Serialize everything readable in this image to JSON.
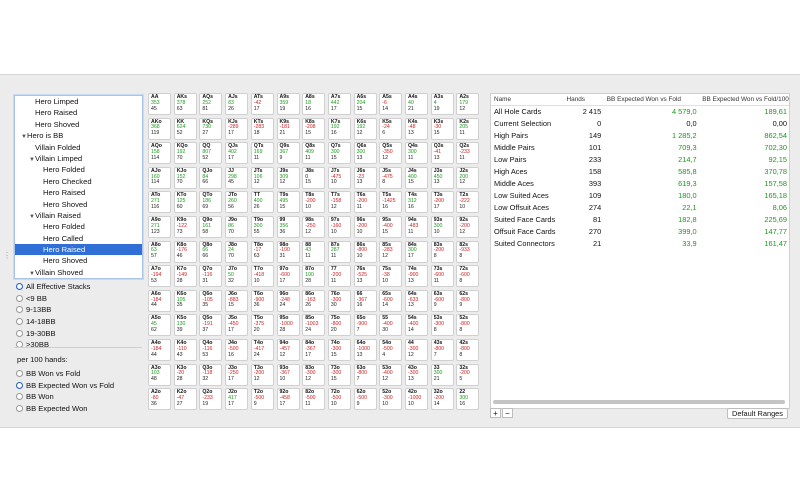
{
  "tree": {
    "items": [
      {
        "label": "Hero Limped",
        "indent": 2,
        "arrow": false,
        "selected": false
      },
      {
        "label": "Hero Raised",
        "indent": 2,
        "arrow": false,
        "selected": false
      },
      {
        "label": "Hero Shoved",
        "indent": 2,
        "arrow": false,
        "selected": false
      },
      {
        "label": "Hero is BB",
        "indent": 1,
        "arrow": true,
        "selected": false
      },
      {
        "label": "Villain Folded",
        "indent": 2,
        "arrow": false,
        "selected": false
      },
      {
        "label": "Villain Limped",
        "indent": 2,
        "arrow": true,
        "selected": false
      },
      {
        "label": "Hero Folded",
        "indent": 3,
        "arrow": false,
        "selected": false
      },
      {
        "label": "Hero Checked",
        "indent": 3,
        "arrow": false,
        "selected": false
      },
      {
        "label": "Hero Raised",
        "indent": 3,
        "arrow": false,
        "selected": false
      },
      {
        "label": "Hero Shoved",
        "indent": 3,
        "arrow": false,
        "selected": false
      },
      {
        "label": "Villain Raised",
        "indent": 2,
        "arrow": true,
        "selected": false
      },
      {
        "label": "Hero Folded",
        "indent": 3,
        "arrow": false,
        "selected": false
      },
      {
        "label": "Hero Called",
        "indent": 3,
        "arrow": false,
        "selected": false
      },
      {
        "label": "Hero Raised",
        "indent": 3,
        "arrow": false,
        "selected": true
      },
      {
        "label": "Hero Shoved",
        "indent": 3,
        "arrow": false,
        "selected": false
      },
      {
        "label": "Villain Shoved",
        "indent": 2,
        "arrow": true,
        "selected": false
      },
      {
        "label": "Hero Folded",
        "indent": 3,
        "arrow": false,
        "selected": false
      }
    ]
  },
  "stacks": {
    "options": [
      {
        "label": "All Effective Stacks",
        "selected": true
      },
      {
        "label": "<9 BB",
        "selected": false
      },
      {
        "label": "9-13BB",
        "selected": false
      },
      {
        "label": "14-18BB",
        "selected": false
      },
      {
        "label": "19-30BB",
        "selected": false
      },
      {
        "label": ">30BB",
        "selected": false
      }
    ]
  },
  "per100": {
    "label": "per 100 hands:",
    "options": [
      {
        "label": "BB Won vs Fold",
        "selected": false
      },
      {
        "label": "BB Expected Won vs Fold",
        "selected": true
      },
      {
        "label": "BB Won",
        "selected": false
      },
      {
        "label": "BB Expected Won",
        "selected": false
      }
    ]
  },
  "grid": {
    "rows": [
      [
        [
          "AA",
          "353",
          "45"
        ],
        [
          "AKs",
          "378",
          "63"
        ],
        [
          "AQs",
          "252",
          "81"
        ],
        [
          "AJs",
          "83",
          "26"
        ],
        [
          "ATs",
          "-42",
          "17"
        ],
        [
          "A9s",
          "359",
          "19"
        ],
        [
          "A8s",
          "18",
          "16"
        ],
        [
          "A7s",
          "442",
          "17"
        ],
        [
          "A6s",
          "204",
          "15"
        ],
        [
          "A5s",
          "-6",
          "14"
        ],
        [
          "A4s",
          "40",
          "21"
        ],
        [
          "A3s",
          "4",
          "19"
        ],
        [
          "A2s",
          "179",
          "12"
        ]
      ],
      [
        [
          "AKo",
          "368",
          "119"
        ],
        [
          "KK",
          "624",
          "52"
        ],
        [
          "KQs",
          "730",
          "27"
        ],
        [
          "KJs",
          "-289",
          "17"
        ],
        [
          "KTs",
          "-283",
          "18"
        ],
        [
          "K9s",
          "-181",
          "21"
        ],
        [
          "K8s",
          "-208",
          "15"
        ],
        [
          "K7s",
          "192",
          "16"
        ],
        [
          "K6s",
          "192",
          "12"
        ],
        [
          "K5s",
          "-24",
          "6"
        ],
        [
          "K4s",
          "-48",
          "13"
        ],
        [
          "K3s",
          "-30",
          "15"
        ],
        [
          "K2s",
          "205",
          "11"
        ]
      ],
      [
        [
          "AQo",
          "158",
          "114"
        ],
        [
          "KQo",
          "192",
          "70"
        ],
        [
          "QQ",
          "807",
          "52"
        ],
        [
          "QJs",
          "402",
          "17"
        ],
        [
          "QTs",
          "169",
          "11"
        ],
        [
          "Q9s",
          "367",
          "9"
        ],
        [
          "Q8s",
          "409",
          "11"
        ],
        [
          "Q7s",
          "300",
          "15"
        ],
        [
          "Q6s",
          "300",
          "13"
        ],
        [
          "Q5s",
          "-350",
          "12"
        ],
        [
          "Q4s",
          "300",
          "11"
        ],
        [
          "Q3s",
          "-41",
          "13"
        ],
        [
          "Q2s",
          "-233",
          "11"
        ]
      ],
      [
        [
          "AJo",
          "160",
          "114"
        ],
        [
          "KJo",
          "152",
          "70"
        ],
        [
          "QJo",
          "84",
          "66"
        ],
        [
          "JJ",
          "298",
          "45"
        ],
        [
          "JTs",
          "106",
          "12"
        ],
        [
          "J9s",
          "309",
          "12"
        ],
        [
          "J8s",
          "0",
          "15"
        ],
        [
          "J7s",
          "-475",
          "10"
        ],
        [
          "J6s",
          "-23",
          "13"
        ],
        [
          "J5s",
          "-475",
          "8"
        ],
        [
          "J4s",
          "400",
          "15"
        ],
        [
          "J3s",
          "450",
          "13"
        ],
        [
          "J2s",
          "200",
          "12"
        ]
      ],
      [
        [
          "ATo",
          "271",
          "116"
        ],
        [
          "KTo",
          "125",
          "60"
        ],
        [
          "QTo",
          "186",
          "69"
        ],
        [
          "JTo",
          "260",
          "56"
        ],
        [
          "TT",
          "400",
          "26"
        ],
        [
          "T9s",
          "495",
          "15"
        ],
        [
          "T8s",
          "-200",
          "10"
        ],
        [
          "T7s",
          "-158",
          "12"
        ],
        [
          "T6s",
          "-200",
          "11"
        ],
        [
          "T5s",
          "-1425",
          "16"
        ],
        [
          "T4s",
          "312",
          "16"
        ],
        [
          "T3s",
          "-200",
          "17"
        ],
        [
          "T2s",
          "-222",
          "10"
        ]
      ],
      [
        [
          "A9o",
          "271",
          "123"
        ],
        [
          "K9o",
          "-122",
          "73"
        ],
        [
          "Q9o",
          "161",
          "58"
        ],
        [
          "J9o",
          "86",
          "70"
        ],
        [
          "T9o",
          "300",
          "55"
        ],
        [
          "99",
          "356",
          "36"
        ],
        [
          "98s",
          "-250",
          "12"
        ],
        [
          "97s",
          "-160",
          "10"
        ],
        [
          "96s",
          "-200",
          "10"
        ],
        [
          "95s",
          "-400",
          "15"
        ],
        [
          "94s",
          "-483",
          "11"
        ],
        [
          "93s",
          "300",
          "10"
        ],
        [
          "92s",
          "-200",
          "12"
        ]
      ],
      [
        [
          "A8o",
          "63",
          "57"
        ],
        [
          "K8o",
          "-176",
          "46"
        ],
        [
          "Q8o",
          "66",
          "66"
        ],
        [
          "J8o",
          "24",
          "70"
        ],
        [
          "T8o",
          "-17",
          "63"
        ],
        [
          "98o",
          "-100",
          "31"
        ],
        [
          "88",
          "43",
          "11"
        ],
        [
          "87s",
          "287",
          "11"
        ],
        [
          "86s",
          "-800",
          "10"
        ],
        [
          "85s",
          "-283",
          "12"
        ],
        [
          "84s",
          "300",
          "17"
        ],
        [
          "83s",
          "-200",
          "8"
        ],
        [
          "82s",
          "-933",
          "8"
        ]
      ],
      [
        [
          "A7o",
          "-194",
          "53"
        ],
        [
          "K7o",
          "-149",
          "28"
        ],
        [
          "Q7o",
          "-116",
          "31"
        ],
        [
          "J7o",
          "50",
          "32"
        ],
        [
          "T7o",
          "-418",
          "10"
        ],
        [
          "97o",
          "-600",
          "17"
        ],
        [
          "87o",
          "100",
          "28"
        ],
        [
          "77",
          "-200",
          "11"
        ],
        [
          "76s",
          "-525",
          "13"
        ],
        [
          "75s",
          "-38",
          "10"
        ],
        [
          "74s",
          "-900",
          "13"
        ],
        [
          "73s",
          "-600",
          "11"
        ],
        [
          "72s",
          "-600",
          "8"
        ]
      ],
      [
        [
          "A6o",
          "-184",
          "44"
        ],
        [
          "K6o",
          "105",
          "35"
        ],
        [
          "Q6o",
          "-105",
          "35"
        ],
        [
          "J6o",
          "-883",
          "15"
        ],
        [
          "T6o",
          "-900",
          "36"
        ],
        [
          "96o",
          "-248",
          "24"
        ],
        [
          "86o",
          "-163",
          "26"
        ],
        [
          "76o",
          "-300",
          "30"
        ],
        [
          "66",
          "-367",
          "16"
        ],
        [
          "65s",
          "-600",
          "14"
        ],
        [
          "64s",
          "-633",
          "13"
        ],
        [
          "63s",
          "-600",
          "9"
        ],
        [
          "62s",
          "-800",
          "9"
        ]
      ],
      [
        [
          "A5o",
          "45",
          "62"
        ],
        [
          "K5o",
          "130",
          "39"
        ],
        [
          "Q5o",
          "-191",
          "37"
        ],
        [
          "J5o",
          "-450",
          "17"
        ],
        [
          "T5o",
          "-375",
          "20"
        ],
        [
          "95o",
          "-1000",
          "28"
        ],
        [
          "85o",
          "-1003",
          "24"
        ],
        [
          "75o",
          "-800",
          "20"
        ],
        [
          "65o",
          "-900",
          "7"
        ],
        [
          "55",
          "-400",
          "30"
        ],
        [
          "54s",
          "-400",
          "14"
        ],
        [
          "53s",
          "-300",
          "8"
        ],
        [
          "52s",
          "-800",
          "8"
        ]
      ],
      [
        [
          "A4o",
          "-184",
          "44"
        ],
        [
          "K4o",
          "-110",
          "43"
        ],
        [
          "Q4o",
          "-116",
          "53"
        ],
        [
          "J4o",
          "-500",
          "16"
        ],
        [
          "T4o",
          "-417",
          "24"
        ],
        [
          "94o",
          "-457",
          "12"
        ],
        [
          "84o",
          "-367",
          "17"
        ],
        [
          "74o",
          "-300",
          "15"
        ],
        [
          "64o",
          "-1000",
          "13"
        ],
        [
          "54o",
          "-500",
          "4"
        ],
        [
          "44",
          "-300",
          "12"
        ],
        [
          "43s",
          "-800",
          "7"
        ],
        [
          "42s",
          "-800",
          "8"
        ]
      ],
      [
        [
          "A3o",
          "103",
          "48"
        ],
        [
          "K3o",
          "-20",
          "28"
        ],
        [
          "Q3o",
          "-118",
          "32"
        ],
        [
          "J3o",
          "-250",
          "17"
        ],
        [
          "T3o",
          "-200",
          "12"
        ],
        [
          "93o",
          "-367",
          "10"
        ],
        [
          "83o",
          "-300",
          "12"
        ],
        [
          "73o",
          "-300",
          "15"
        ],
        [
          "63o",
          "-800",
          "7"
        ],
        [
          "53o",
          "-400",
          "12"
        ],
        [
          "43o",
          "-300",
          "13"
        ],
        [
          "33",
          "300",
          "21"
        ],
        [
          "32s",
          "-200",
          "5"
        ]
      ],
      [
        [
          "A2o",
          "-80",
          "36"
        ],
        [
          "K2o",
          "-47",
          "27"
        ],
        [
          "Q2o",
          "-233",
          "19"
        ],
        [
          "J2o",
          "417",
          "17"
        ],
        [
          "T2o",
          "-500",
          "9"
        ],
        [
          "92o",
          "-458",
          "17"
        ],
        [
          "82o",
          "-500",
          "11"
        ],
        [
          "72o",
          "-500",
          "10"
        ],
        [
          "62o",
          "-500",
          "9"
        ],
        [
          "52o",
          "-300",
          "10"
        ],
        [
          "42o",
          "-1000",
          "10"
        ],
        [
          "32o",
          "-200",
          "14"
        ],
        [
          "22",
          "300",
          "16"
        ]
      ]
    ]
  },
  "table": {
    "headers": [
      "Name",
      "Hands",
      "BB Expected Won vs Fold",
      "BB Expected Won vs Fold/100 h..."
    ],
    "rows": [
      [
        "All Hole Cards",
        "2 415",
        "4 579,0",
        "189,61"
      ],
      [
        "Current Selection",
        "0",
        "0,0",
        "0,00"
      ],
      [
        "High Pairs",
        "149",
        "1 285,2",
        "862,54"
      ],
      [
        "Middle Pairs",
        "101",
        "709,3",
        "702,30"
      ],
      [
        "Low Pairs",
        "233",
        "214,7",
        "92,15"
      ],
      [
        "High Aces",
        "158",
        "585,8",
        "370,78"
      ],
      [
        "Middle Aces",
        "393",
        "619,3",
        "157,58"
      ],
      [
        "Low Suited Aces",
        "109",
        "180,0",
        "165,18"
      ],
      [
        "Low Offsuit Aces",
        "274",
        "22,1",
        "8,06"
      ],
      [
        "Suited Face Cards",
        "81",
        "182,8",
        "225,69"
      ],
      [
        "Offsuit Face Cards",
        "270",
        "399,0",
        "147,77"
      ],
      [
        "Suited Connectors",
        "21",
        "33,9",
        "161,47"
      ]
    ],
    "add_label": "+",
    "remove_label": "−",
    "default_ranges_label": "Default Ranges"
  },
  "colors": {
    "positive": "#1a9a1a",
    "negative": "#d02020",
    "selection": "#2f6fd6"
  }
}
